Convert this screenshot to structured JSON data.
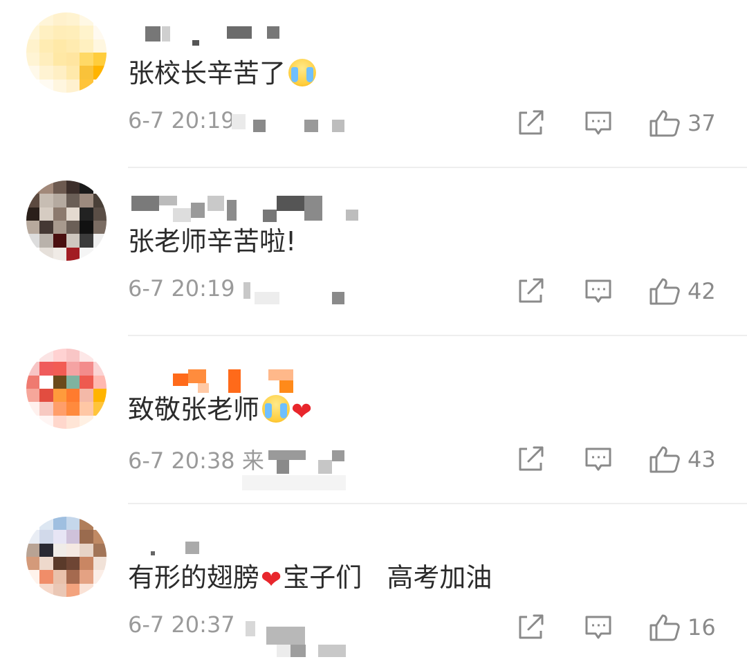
{
  "comments": [
    {
      "text": "张校长辛苦了",
      "emoji": [
        "cry"
      ],
      "time": "6-7 20:19",
      "likes": "37"
    },
    {
      "text": "张老师辛苦啦!",
      "emoji": [],
      "time": "6-7 20:19",
      "likes": "42"
    },
    {
      "text": "致敬张老师",
      "emoji": [
        "cry",
        "heart"
      ],
      "time": "6-7 20:38 来",
      "likes": "43"
    },
    {
      "text_before": "有形的翅膀",
      "text_after": "宝子们   高考加油",
      "emoji": [
        "heart"
      ],
      "time": "6-7 20:37",
      "likes": "16"
    }
  ],
  "icons": {
    "share": "share-icon",
    "reply": "comment-icon",
    "like": "thumbs-up-icon"
  },
  "colors": {
    "text": "#2b2b2b",
    "meta": "#9a9a9a",
    "heart": "#e8262c"
  }
}
